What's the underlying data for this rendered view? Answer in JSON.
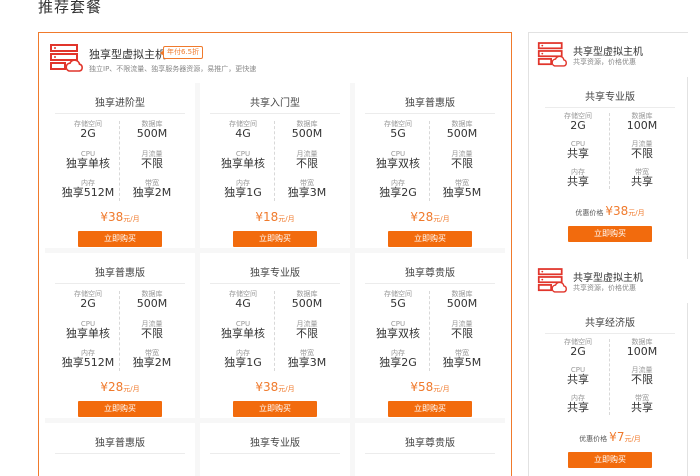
{
  "section_title": "推荐套餐",
  "main": {
    "title": "独享型虚拟主机",
    "badge": "年付6.5折",
    "subtitle": "独立IP、不限流量、独享服务器资源，易推广，更快速",
    "labels": {
      "storage": "存储空间",
      "db": "数据库",
      "cpu": "CPU",
      "traffic": "月流量",
      "memory": "内存",
      "bandwidth": "带宽",
      "currency": "¥",
      "unit": "元/月",
      "buy": "立即购买"
    },
    "cards": [
      {
        "name": "独享进阶型",
        "storage": "2G",
        "db": "500M",
        "cpu": "独享单核",
        "traffic": "不限",
        "memory": "独享512M",
        "bandwidth": "独享2M",
        "price": "38"
      },
      {
        "name": "共享入门型",
        "storage": "4G",
        "db": "500M",
        "cpu": "独享单核",
        "traffic": "不限",
        "memory": "独享1G",
        "bandwidth": "独享3M",
        "price": "18"
      },
      {
        "name": "独享普惠版",
        "storage": "5G",
        "db": "500M",
        "cpu": "独享双核",
        "traffic": "不限",
        "memory": "独享2G",
        "bandwidth": "独享5M",
        "price": "28"
      },
      {
        "name": "独享普惠版",
        "storage": "2G",
        "db": "500M",
        "cpu": "独享单核",
        "traffic": "不限",
        "memory": "独享512M",
        "bandwidth": "独享2M",
        "price": "28"
      },
      {
        "name": "独享专业版",
        "storage": "4G",
        "db": "500M",
        "cpu": "独享单核",
        "traffic": "不限",
        "memory": "独享1G",
        "bandwidth": "独享3M",
        "price": "38"
      },
      {
        "name": "独享尊贵版",
        "storage": "5G",
        "db": "500M",
        "cpu": "独享双核",
        "traffic": "不限",
        "memory": "独享2G",
        "bandwidth": "独享5M",
        "price": "58"
      },
      {
        "name": "独享普惠版"
      },
      {
        "name": "独享专业版"
      },
      {
        "name": "独享尊贵版"
      }
    ]
  },
  "side": {
    "labels": {
      "storage": "存储空间",
      "db": "数据库",
      "cpu": "CPU",
      "traffic": "月流量",
      "memory": "内存",
      "bandwidth": "带宽",
      "price_prefix": "优惠价格",
      "currency": "¥",
      "unit": "元/月",
      "buy": "立即购买"
    },
    "blocks": [
      {
        "title": "共享型虚拟主机",
        "subtitle": "共享资源，价格优惠",
        "name": "共享专业版",
        "storage": "2G",
        "db": "100M",
        "cpu": "共享",
        "traffic": "不限",
        "memory": "共享",
        "bandwidth": "共享",
        "price": "38"
      },
      {
        "title": "共享型虚拟主机",
        "subtitle": "共享资源，价格优惠",
        "name": "共享经济版",
        "storage": "2G",
        "db": "100M",
        "cpu": "共享",
        "traffic": "不限",
        "memory": "共享",
        "bandwidth": "共享",
        "price": "7"
      }
    ]
  },
  "colors": {
    "accent": "#f07a2c",
    "button": "#f26b0d"
  }
}
